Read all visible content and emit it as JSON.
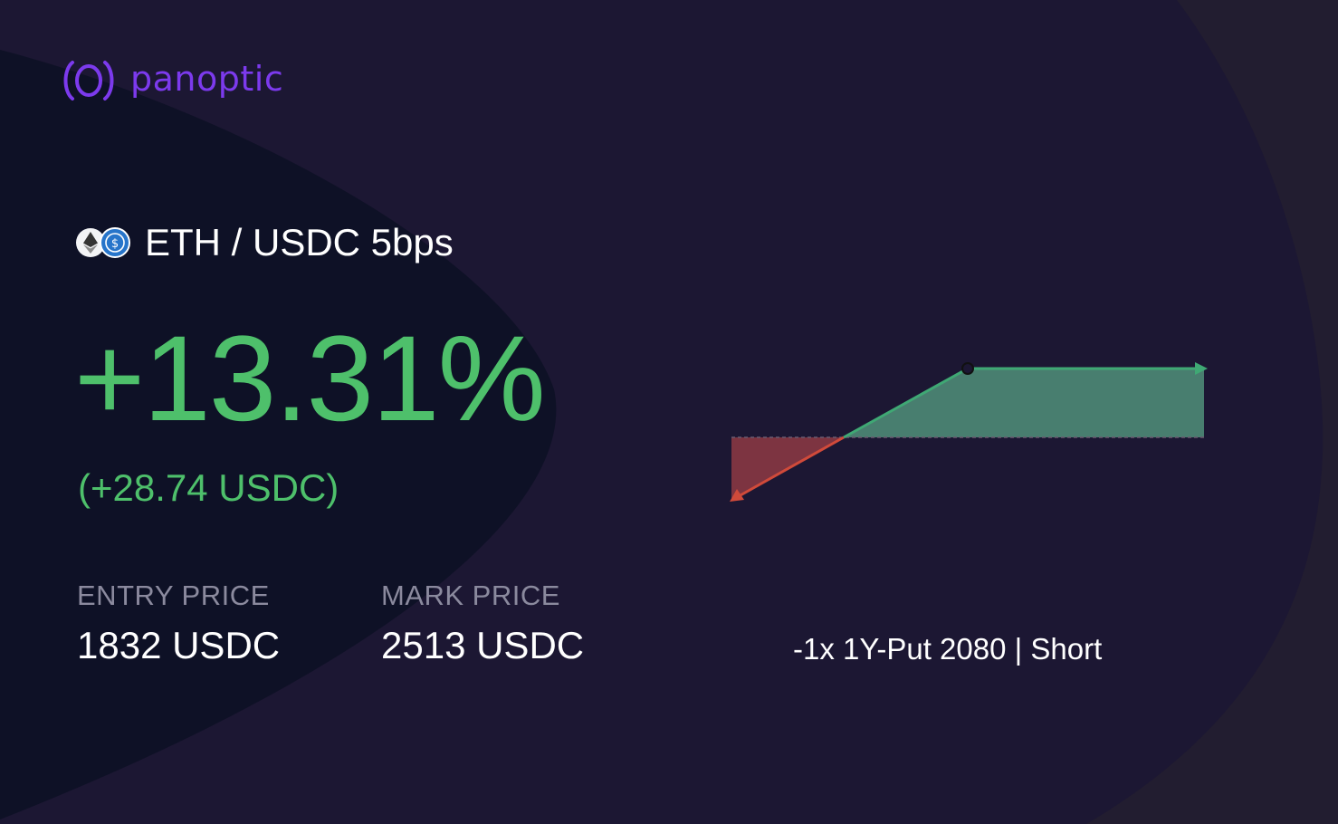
{
  "brand": {
    "name": "panoptic",
    "color": "#7c3aed"
  },
  "pool": {
    "label": "ETH / USDC 5bps",
    "token0_icon": "eth-token-icon",
    "token1_icon": "usdc-token-icon"
  },
  "pnl": {
    "percent": "+13.31%",
    "amount": "(+28.74 USDC)",
    "color": "#4ec06b"
  },
  "prices": {
    "entry_label": "ENTRY PRICE",
    "entry_value": "1832 USDC",
    "mark_label": "MARK PRICE",
    "mark_value": "2513 USDC"
  },
  "position": {
    "description": "-1x 1Y-Put 2080 | Short"
  },
  "colors": {
    "background": "#1c1733",
    "dark_region": "#0e1126",
    "profit": "#4e8a76",
    "loss": "#8e3a44"
  }
}
